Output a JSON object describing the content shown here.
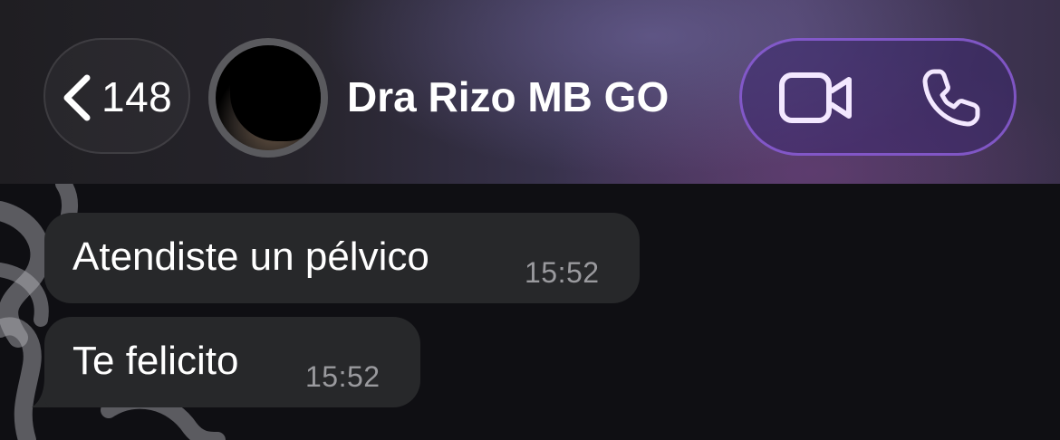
{
  "header": {
    "back_icon": "chevron-left-icon",
    "unread_count": "148",
    "contact_name": "Dra Rizo MB GO",
    "video_icon": "video-camera-icon",
    "phone_icon": "phone-icon",
    "accent_color": "#9664e6"
  },
  "messages": [
    {
      "text": "Atendiste un pélvico",
      "time": "15:52",
      "direction": "incoming"
    },
    {
      "text": "Te felicito",
      "time": "15:52",
      "direction": "incoming"
    }
  ]
}
